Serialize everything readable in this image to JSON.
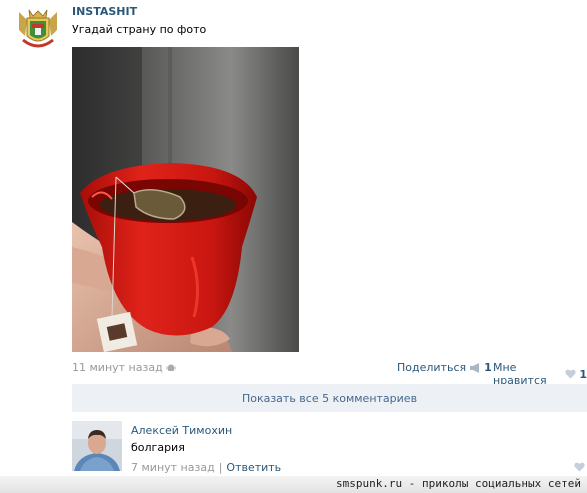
{
  "post": {
    "author": "INSTASHIT",
    "text": "Угадай страну по фото",
    "photo_alt": "photo",
    "time": "11 минут назад",
    "share_label": "Поделиться",
    "share_count": "1",
    "like_label": "Мне нравится",
    "like_count": "1"
  },
  "comments_bar": {
    "label": "Показать все 5 комментариев"
  },
  "comment": {
    "author": "Алексей Тимохин",
    "text": "болгария",
    "time": "7 минут назад",
    "separator": "|",
    "reply": "Ответить"
  },
  "footer": {
    "text": "smspunk.ru - приколы социальных сетей"
  },
  "colors": {
    "link": "#2b587a",
    "muted": "#999999",
    "bar_bg": "#edf1f5"
  }
}
